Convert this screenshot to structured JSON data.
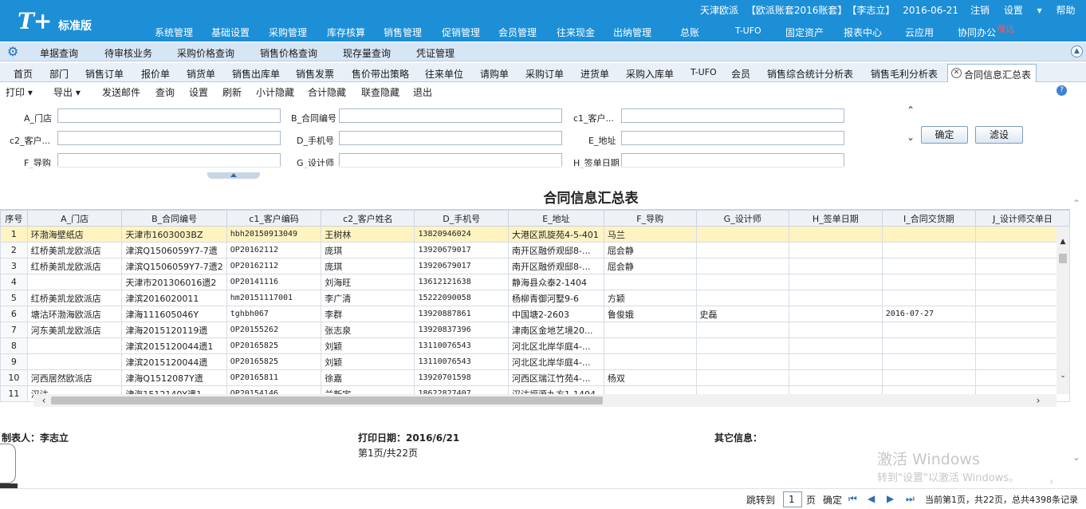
{
  "app": {
    "logo": "T+",
    "edition": "标准版",
    "company": "天津欧派",
    "account": "【欧派账套2016账套】",
    "user": "【李志立】",
    "date": "2016-06-21",
    "logout": "注销",
    "settings": "设置",
    "help": "帮助",
    "hint": "嘿话"
  },
  "main_nav": [
    "系统管理",
    "基础设置",
    "采购管理",
    "库存核算",
    "销售管理",
    "促销管理",
    "会员管理",
    "往来现金",
    "出纳管理",
    "总账",
    "T-UFO",
    "固定资产",
    "报表中心",
    "云应用",
    "协同办公"
  ],
  "sub_nav": [
    "单据查询",
    "待审核业务",
    "采购价格查询",
    "销售价格查询",
    "现存量查询",
    "凭证管理"
  ],
  "tabs": [
    "首页",
    "部门",
    "销售订单",
    "报价单",
    "销货单",
    "销售出库单",
    "销售发票",
    "售价带出策略",
    "往来单位",
    "请购单",
    "采购订单",
    "进货单",
    "采购入库单",
    "T-UFO",
    "会员",
    "销售综合统计分析表",
    "销售毛利分析表"
  ],
  "active_tab": "合同信息汇总表",
  "toolbar": {
    "print": "打印",
    "export": "导出",
    "items": [
      "发送邮件",
      "查询",
      "设置",
      "刷新",
      "小计隐藏",
      "合计隐藏",
      "联查隐藏",
      "退出"
    ]
  },
  "filters": {
    "a_store": "A_门店",
    "b_contract": "B_合同编号",
    "c1_customer": "c1_客户...",
    "c2_customer": "c2_客户...",
    "d_phone": "D_手机号",
    "e_address": "E_地址",
    "f_guide": "F_导购",
    "g_designer": "G_设计师",
    "h_signdate": "H_签单日期",
    "confirm": "确定",
    "filter_settings": "滤设"
  },
  "report": {
    "title": "合同信息汇总表",
    "columns": [
      "序号",
      "A_门店",
      "B_合同编号",
      "c1_客户编码",
      "c2_客户姓名",
      "D_手机号",
      "E_地址",
      "F_导购",
      "G_设计师",
      "H_签单日期",
      "I_合同交货期",
      "J_设计师交单日"
    ],
    "rows": [
      [
        "1",
        "环渤海壁纸店",
        "天津市1603003BZ",
        "hbh20150913049",
        "王树林",
        "13820946024",
        "大港区凯旋苑4-5-401",
        "马兰",
        "",
        "",
        "",
        ""
      ],
      [
        "2",
        "红桥美凯龙欧派店",
        "津滨Q1506059Y7-7遗",
        "OP20162112",
        "庞琪",
        "13920679017",
        "南开区融侨观邸8-...",
        "屈会静",
        "",
        "",
        "",
        ""
      ],
      [
        "3",
        "红桥美凯龙欧派店",
        "津滨Q1506059Y7-7遗2",
        "OP20162112",
        "庞琪",
        "13920679017",
        "南开区融侨观邸8-...",
        "屈会静",
        "",
        "",
        "",
        ""
      ],
      [
        "4",
        "",
        "天津市201306016遗2",
        "OP20141116",
        "刘海旺",
        "13612121638",
        "静海县众泰2-1404",
        "",
        "",
        "",
        "",
        ""
      ],
      [
        "5",
        "红桥美凯龙欧派店",
        "津滨2016020011",
        "hm20151117001",
        "李广清",
        "15222090058",
        "杨柳青御河墅9-6",
        "方颖",
        "",
        "",
        "",
        ""
      ],
      [
        "6",
        "塘沽环渤海欧派店",
        "津海111605046Y",
        "tghbh067",
        "李群",
        "13920887861",
        "中国塘2-2603",
        "鲁俊娥",
        "史磊",
        "",
        "2016-07-27",
        ""
      ],
      [
        "7",
        "河东美凯龙欧派店",
        "津海2015120119遗",
        "OP20155262",
        "张志泉",
        "13920837396",
        "津南区金地艺境20...",
        "",
        "",
        "",
        "",
        ""
      ],
      [
        "8",
        "",
        "津滨2015120044遗1",
        "OP20165825",
        "刘颖",
        "13110076543",
        "河北区北岸华庭4-...",
        "",
        "",
        "",
        "",
        ""
      ],
      [
        "9",
        "",
        "津滨2015120044遗",
        "OP20165825",
        "刘颖",
        "13110076543",
        "河北区北岸华庭4-...",
        "",
        "",
        "",
        "",
        ""
      ],
      [
        "10",
        "河西居然欧派店",
        "津海Q1512087Y遗",
        "OP20165811",
        "徐嘉",
        "13920701598",
        "河西区瑞江竹苑4-...",
        "杨双",
        "",
        "",
        "",
        ""
      ],
      [
        "11",
        "汉沽",
        "津海1512140Y遗1",
        "OP20154146",
        "兰新宇",
        "18622827407",
        "汉沽福源九方1-1404",
        "",
        "",
        "",
        "",
        ""
      ]
    ]
  },
  "footer": {
    "maker_label": "制表人：",
    "maker": "李志立",
    "print_date_label": "打印日期：",
    "print_date": "2016/6/21",
    "other_label": "其它信息：",
    "page_info": "第1页/共22页"
  },
  "watermark": {
    "line1": "激活 Windows",
    "line2": "转到\"设置\"以激活 Windows。"
  },
  "status": {
    "goto": "跳转到",
    "page_value": "1",
    "page_unit": "页",
    "confirm": "确定",
    "summary": "当前第1页，共22页，总共4398条记录"
  }
}
